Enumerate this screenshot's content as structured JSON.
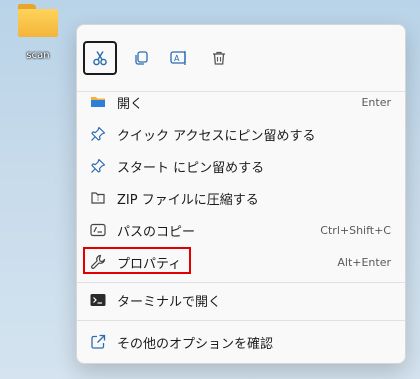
{
  "desktop": {
    "folder_label": "scan"
  },
  "context_menu": {
    "icon_bar": [
      {
        "name": "cut-icon"
      },
      {
        "name": "copy-icon"
      },
      {
        "name": "rename-icon"
      },
      {
        "name": "delete-icon"
      }
    ],
    "items": [
      {
        "label": "開く",
        "shortcut": "Enter",
        "icon": "folder-open-icon"
      },
      {
        "label": "クイック アクセスにピン留めする",
        "shortcut": "",
        "icon": "pin-icon"
      },
      {
        "label": "スタート にピン留めする",
        "shortcut": "",
        "icon": "pin-icon"
      },
      {
        "label": "ZIP ファイルに圧縮する",
        "shortcut": "",
        "icon": "zip-icon"
      },
      {
        "label": "パスのコピー",
        "shortcut": "Ctrl+Shift+C",
        "icon": "copy-path-icon"
      },
      {
        "label": "プロパティ",
        "shortcut": "Alt+Enter",
        "icon": "wrench-icon"
      },
      {
        "label": "ターミナルで開く",
        "shortcut": "",
        "icon": "terminal-icon"
      },
      {
        "label": "その他のオプションを確認",
        "shortcut": "",
        "icon": "share-icon"
      }
    ],
    "highlight_color": "#e00000",
    "accent_color": "#1a73e8"
  }
}
